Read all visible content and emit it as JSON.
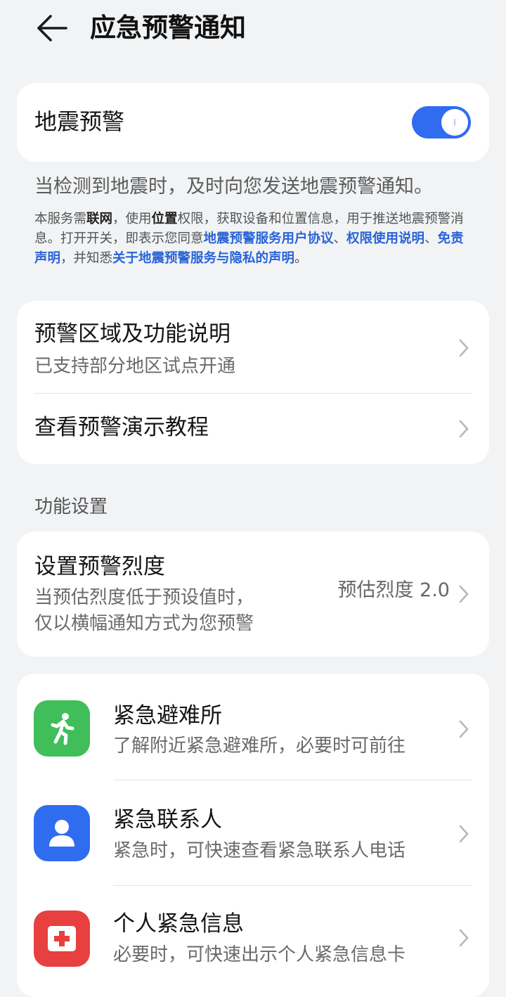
{
  "header": {
    "title": "应急预警通知"
  },
  "earthquake_card": {
    "label": "地震预警",
    "toggle_on": true,
    "accent_color": "#2f6cf0"
  },
  "description": {
    "main": "当检测到地震时，及时向您发送地震预警通知。",
    "legal": {
      "t1": "本服务需",
      "b1": "联网",
      "t2": "，使用",
      "b2": "位置",
      "t3": "权限，获取设备和位置信息，用于推送地震预警消息。打开开关，即表示您同意",
      "l1": "地震预警服务用户协议",
      "t4": "、",
      "l2": "权限使用说明",
      "t5": "、",
      "l3": "免责声明",
      "t6": "，并知悉",
      "l4": "关于地震预警服务与隐私的声明",
      "t7": "。",
      "link_color": "#2a64d6"
    }
  },
  "region_card": {
    "items": [
      {
        "title": "预警区域及功能说明",
        "subtitle": "已支持部分地区试点开通"
      },
      {
        "title": "查看预警演示教程"
      }
    ]
  },
  "settings": {
    "section_label": "功能设置",
    "intensity": {
      "title": "设置预警烈度",
      "desc_line1": "当预估烈度低于预设值时，",
      "desc_line2": "仅以横幅通知方式为您预警",
      "value": "预估烈度 2.0"
    }
  },
  "emergency_card": {
    "items": [
      {
        "title": "紧急避难所",
        "subtitle": "了解附近紧急避难所，必要时可前往",
        "icon": "running-person-icon",
        "color": "#3fbe5a"
      },
      {
        "title": "紧急联系人",
        "subtitle": "紧急时，可快速查看紧急联系人电话",
        "icon": "person-icon",
        "color": "#2f6cf0"
      },
      {
        "title": "个人紧急信息",
        "subtitle": "必要时，可快速出示个人紧急信息卡",
        "icon": "medical-cross-icon",
        "color": "#e83f3f"
      }
    ]
  }
}
